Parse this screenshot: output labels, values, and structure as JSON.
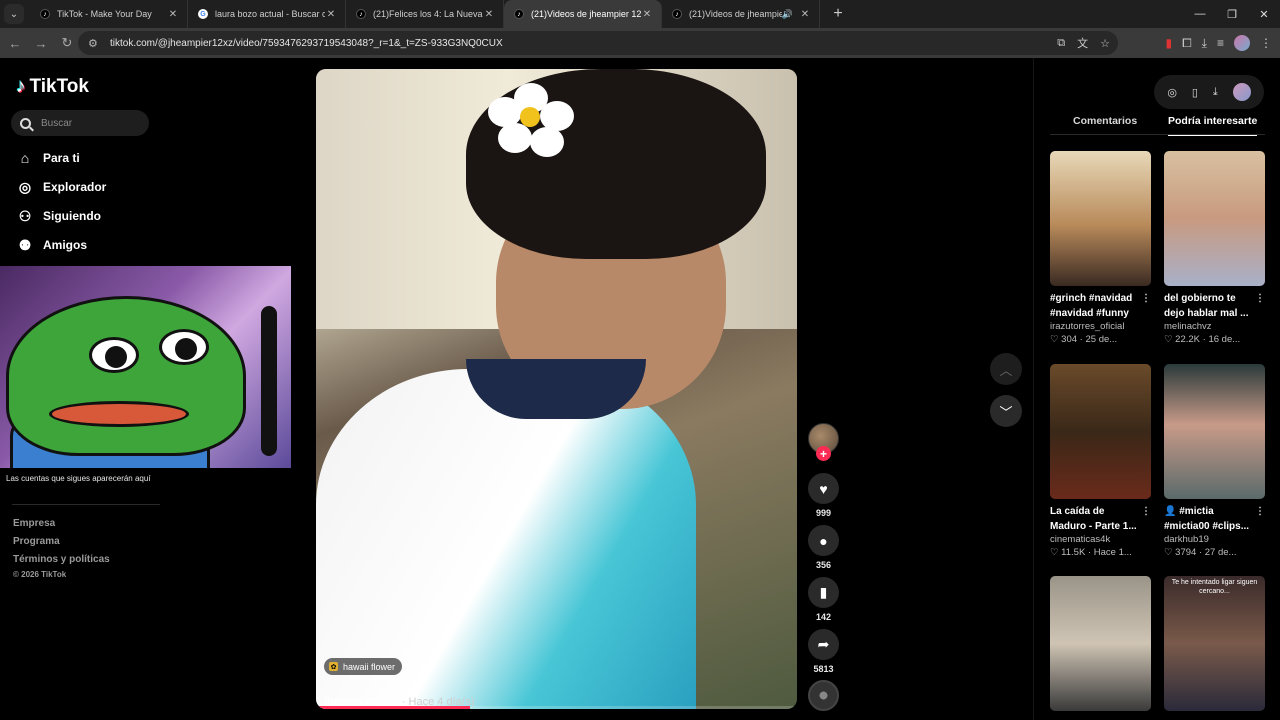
{
  "browser": {
    "tabs": [
      {
        "title": "TikTok - Make Your Day",
        "favicon": "tiktok-icon",
        "active": false
      },
      {
        "title": "laura bozo actual - Buscar con Google",
        "favicon": "google-icon",
        "active": false
      },
      {
        "title": "(21)Felices los 4: La Nueva Sensación",
        "favicon": "tiktok-icon",
        "active": false
      },
      {
        "title": "(21)Videos de jheampier 12 (@jheampier12xz)",
        "favicon": "tiktok-icon",
        "active": true
      },
      {
        "title": "(21)Videos de jheampier 12 (@jheampier12xz)",
        "favicon": "tiktok-icon",
        "active": false,
        "audio": true
      }
    ],
    "url": "tiktok.com/@jheampier12xz/video/7593476293719543048?_r=1&_t=ZS-933G3NQ0CUX"
  },
  "sidebar": {
    "logo": "TikTok",
    "search_placeholder": "Buscar",
    "nav": [
      {
        "label": "Para ti",
        "icon": "home-icon"
      },
      {
        "label": "Explorador",
        "icon": "compass-icon"
      },
      {
        "label": "Siguiendo",
        "icon": "following-icon"
      },
      {
        "label": "Amigos",
        "icon": "friends-icon"
      }
    ],
    "note": "Las cuentas que sigues aparecerán aquí",
    "footer": [
      "Empresa",
      "Programa",
      "Términos y políticas"
    ],
    "copyright": "© 2026 TikTok"
  },
  "video": {
    "sound": "hawaii flower",
    "author": "jheampier12xz",
    "date": "· Hace 4 día(s)",
    "progress": 0.32
  },
  "actions": {
    "likes": "999",
    "comments": "356",
    "saves": "142",
    "shares": "5813"
  },
  "panel": {
    "tabs": [
      "Comentarios",
      "Podría interesarte"
    ],
    "active_tab": "Podría interesarte",
    "cards": [
      {
        "caption": "#grinch #navidad #navidad #funny",
        "author": "irazutorres_oficial",
        "likes": "304",
        "date": "25 de..."
      },
      {
        "caption": "del gobierno te dejo hablar mal ...",
        "author": "melinachvz",
        "likes": "22.2K",
        "date": "16 de..."
      },
      {
        "caption": "La caída de Maduro - Parte 1...",
        "author": "cinematicas4k",
        "likes": "11.5K",
        "date": "Hace 1..."
      },
      {
        "caption": "#mictia #mictia00 #clips...",
        "author": "darkhub19",
        "likes": "3794",
        "date": "27 de..."
      },
      {
        "caption": "",
        "author": "",
        "likes": "",
        "date": ""
      },
      {
        "caption": "Te he intentado ligar siguen cercano...",
        "author": "",
        "likes": "",
        "date": ""
      }
    ]
  }
}
